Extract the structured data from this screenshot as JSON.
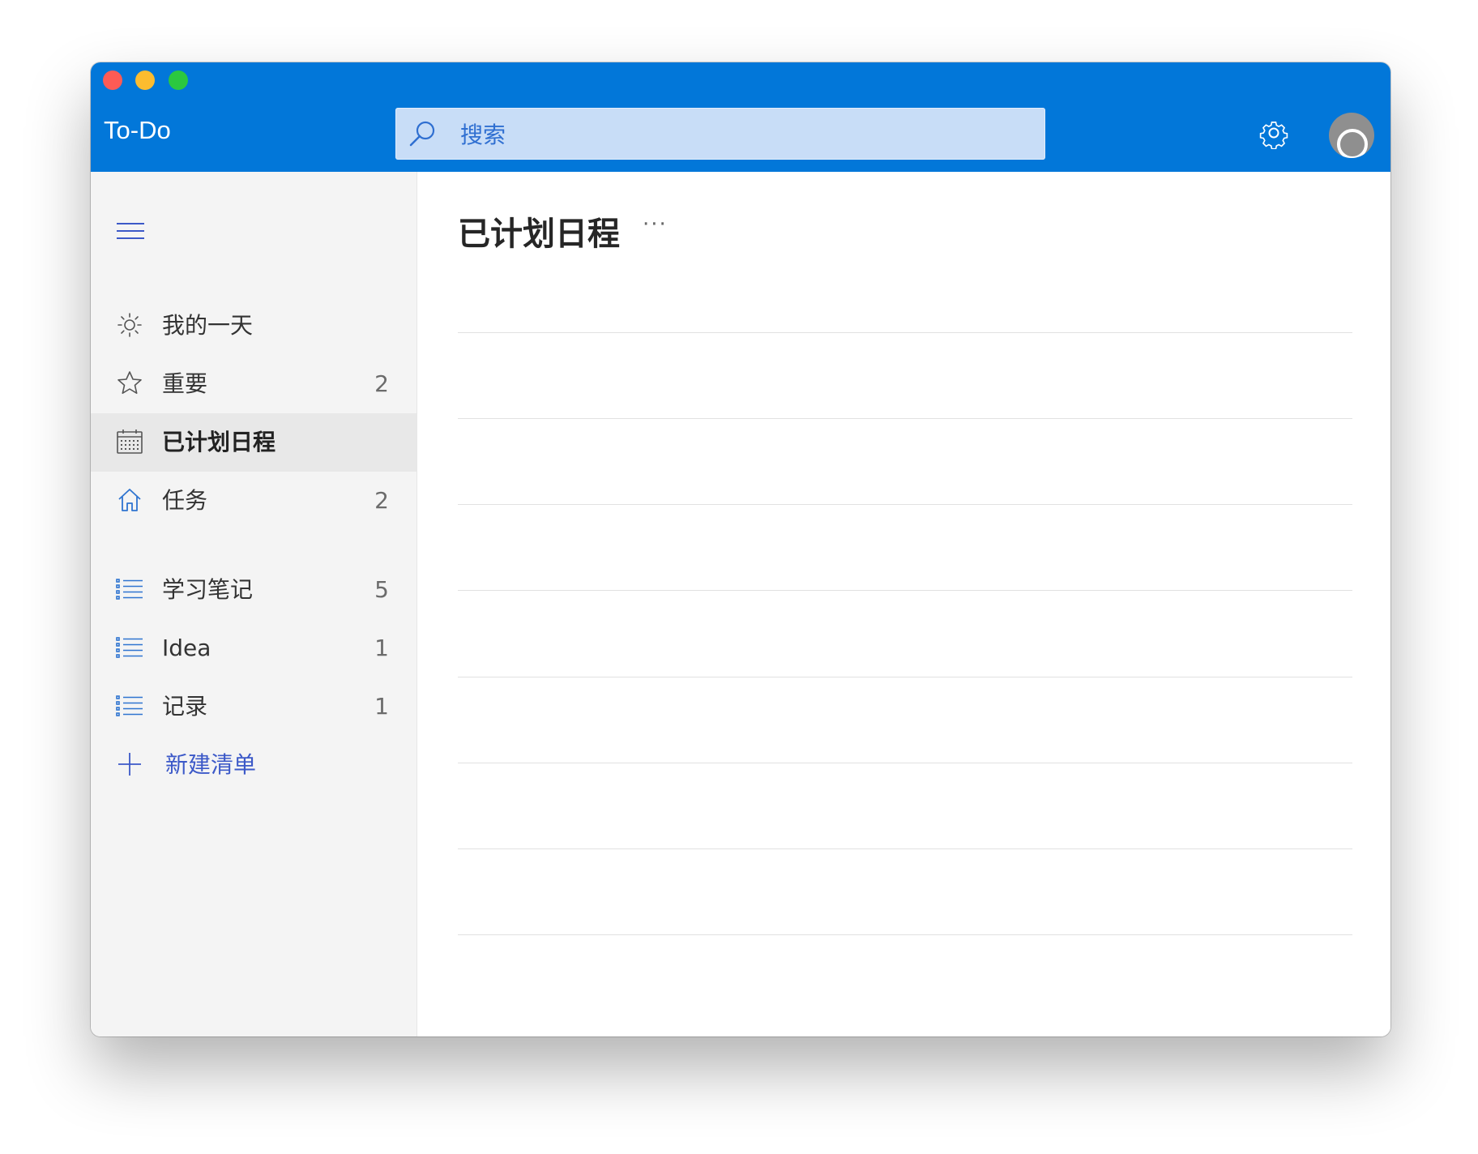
{
  "app": {
    "title": "To-Do"
  },
  "search": {
    "placeholder": "搜索"
  },
  "sidebar": {
    "smart_lists": [
      {
        "label": "我的一天",
        "count": "",
        "icon": "sun-icon"
      },
      {
        "label": "重要",
        "count": "2",
        "icon": "star-icon"
      },
      {
        "label": "已计划日程",
        "count": "",
        "icon": "calendar-icon",
        "selected": true
      },
      {
        "label": "任务",
        "count": "2",
        "icon": "home-icon"
      }
    ],
    "lists": [
      {
        "label": "学习笔记",
        "count": "5",
        "icon": "list-icon"
      },
      {
        "label": "Idea",
        "count": "1",
        "icon": "list-icon"
      },
      {
        "label": "记录",
        "count": "1",
        "icon": "list-icon"
      }
    ],
    "new_list_label": "新建清单"
  },
  "main": {
    "title": "已计划日程",
    "more_label": "···"
  },
  "colors": {
    "titlebar": "#0277d9",
    "accent": "#3c59c8",
    "sidebar_bg": "#f4f4f4",
    "selected_bg": "#e8e8e8"
  }
}
